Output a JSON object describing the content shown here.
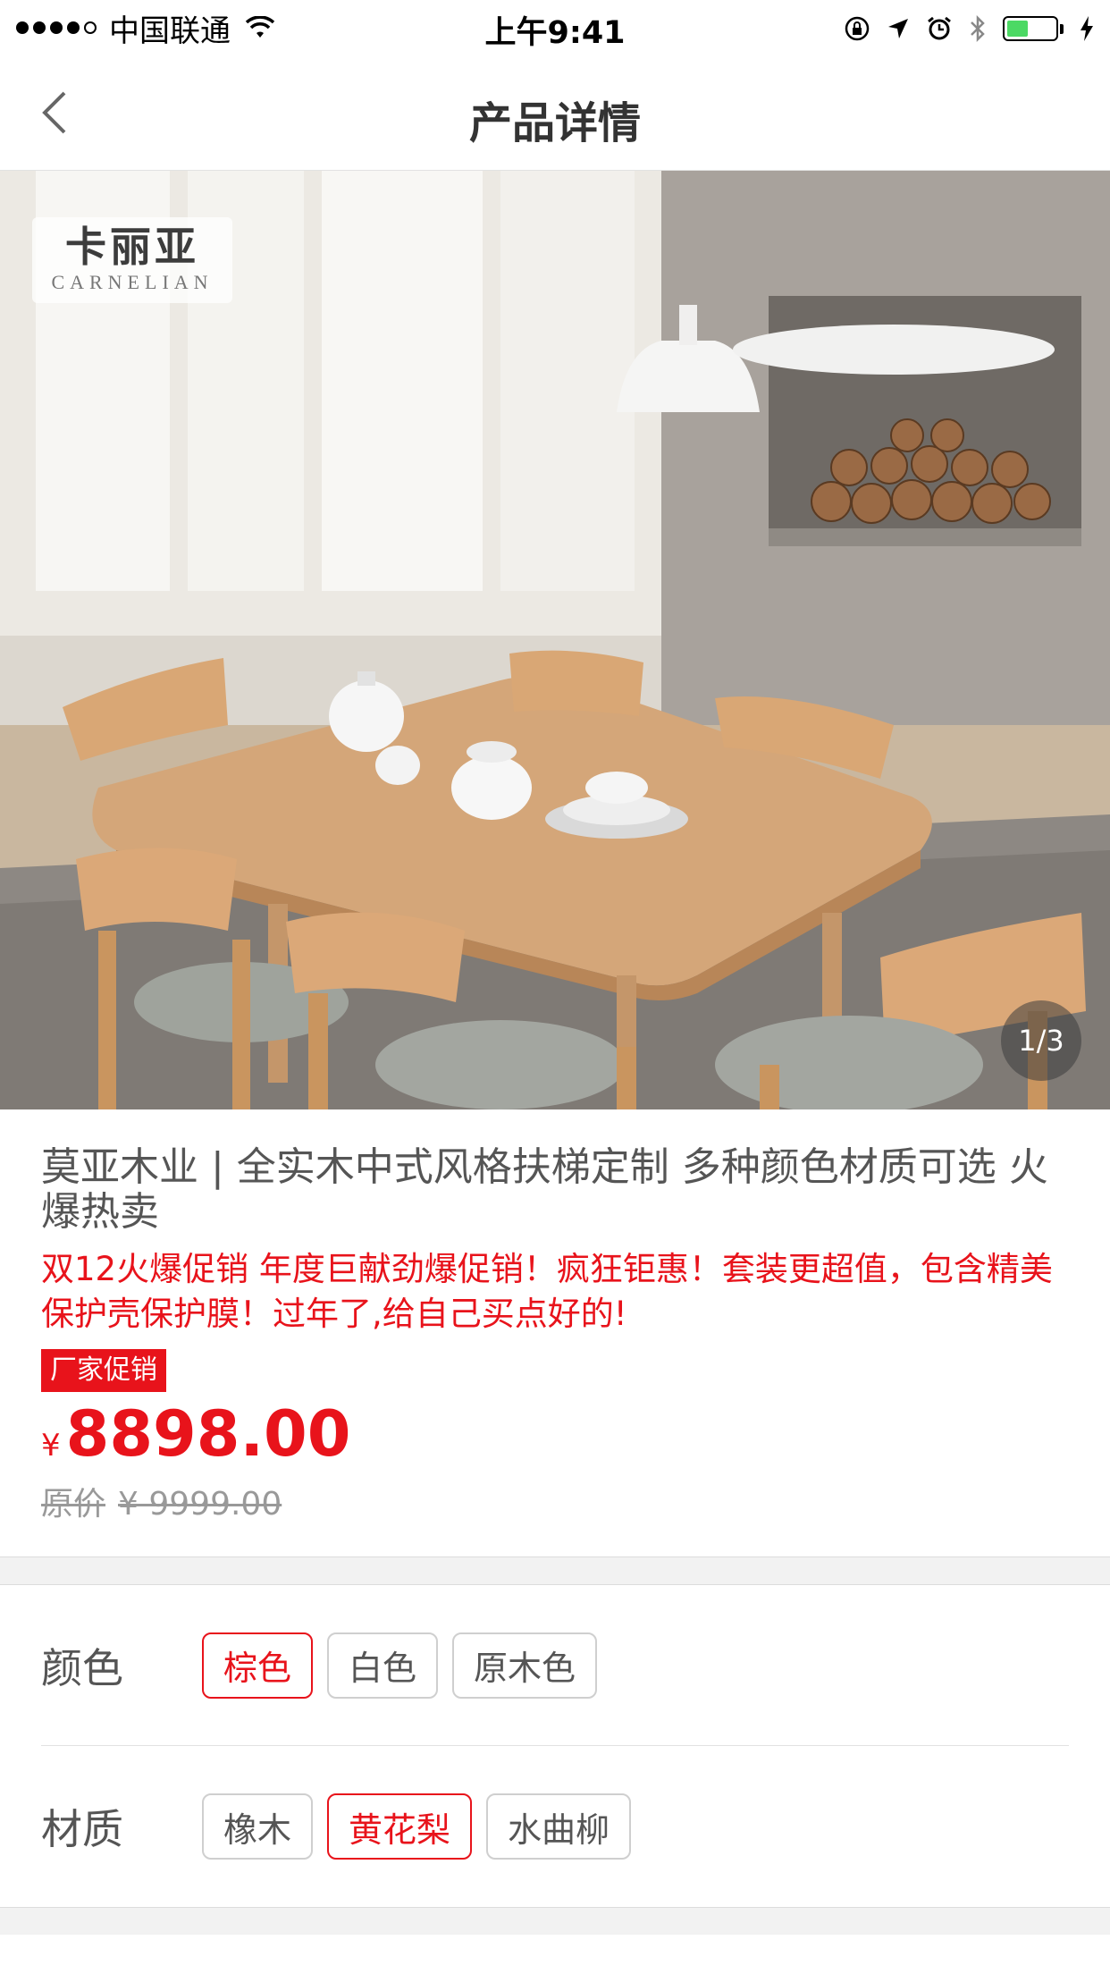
{
  "status_bar": {
    "carrier": "中国联通",
    "time": "上午9:41",
    "battery_level": 0.45
  },
  "nav": {
    "title": "产品详情",
    "back_icon": "chevron-left-icon"
  },
  "gallery": {
    "brand_cn": "卡丽亚",
    "brand_en": "CARNELIAN",
    "counter": "1/3"
  },
  "product": {
    "title": "莫亚木业 | 全实木中式风格扶梯定制 多种颜色材质可选 火爆热卖",
    "promo": "双12火爆促销 年度巨献劲爆促销！疯狂钜惠！套装更超值，包含精美保护壳保护膜！过年了,给自己买点好的!",
    "badge": "厂家促销",
    "currency": "¥",
    "price": "8898.00",
    "original_label": "原价",
    "original_price": "¥ 9999.00"
  },
  "options": {
    "color": {
      "label": "颜色",
      "choices": [
        "棕色",
        "白色",
        "原木色"
      ],
      "selected": "棕色"
    },
    "material": {
      "label": "材质",
      "choices": [
        "橡木",
        "黄花梨",
        "水曲柳"
      ],
      "selected": "黄花梨"
    }
  },
  "colors": {
    "accent": "#e8131b",
    "battery": "#4cd964"
  }
}
